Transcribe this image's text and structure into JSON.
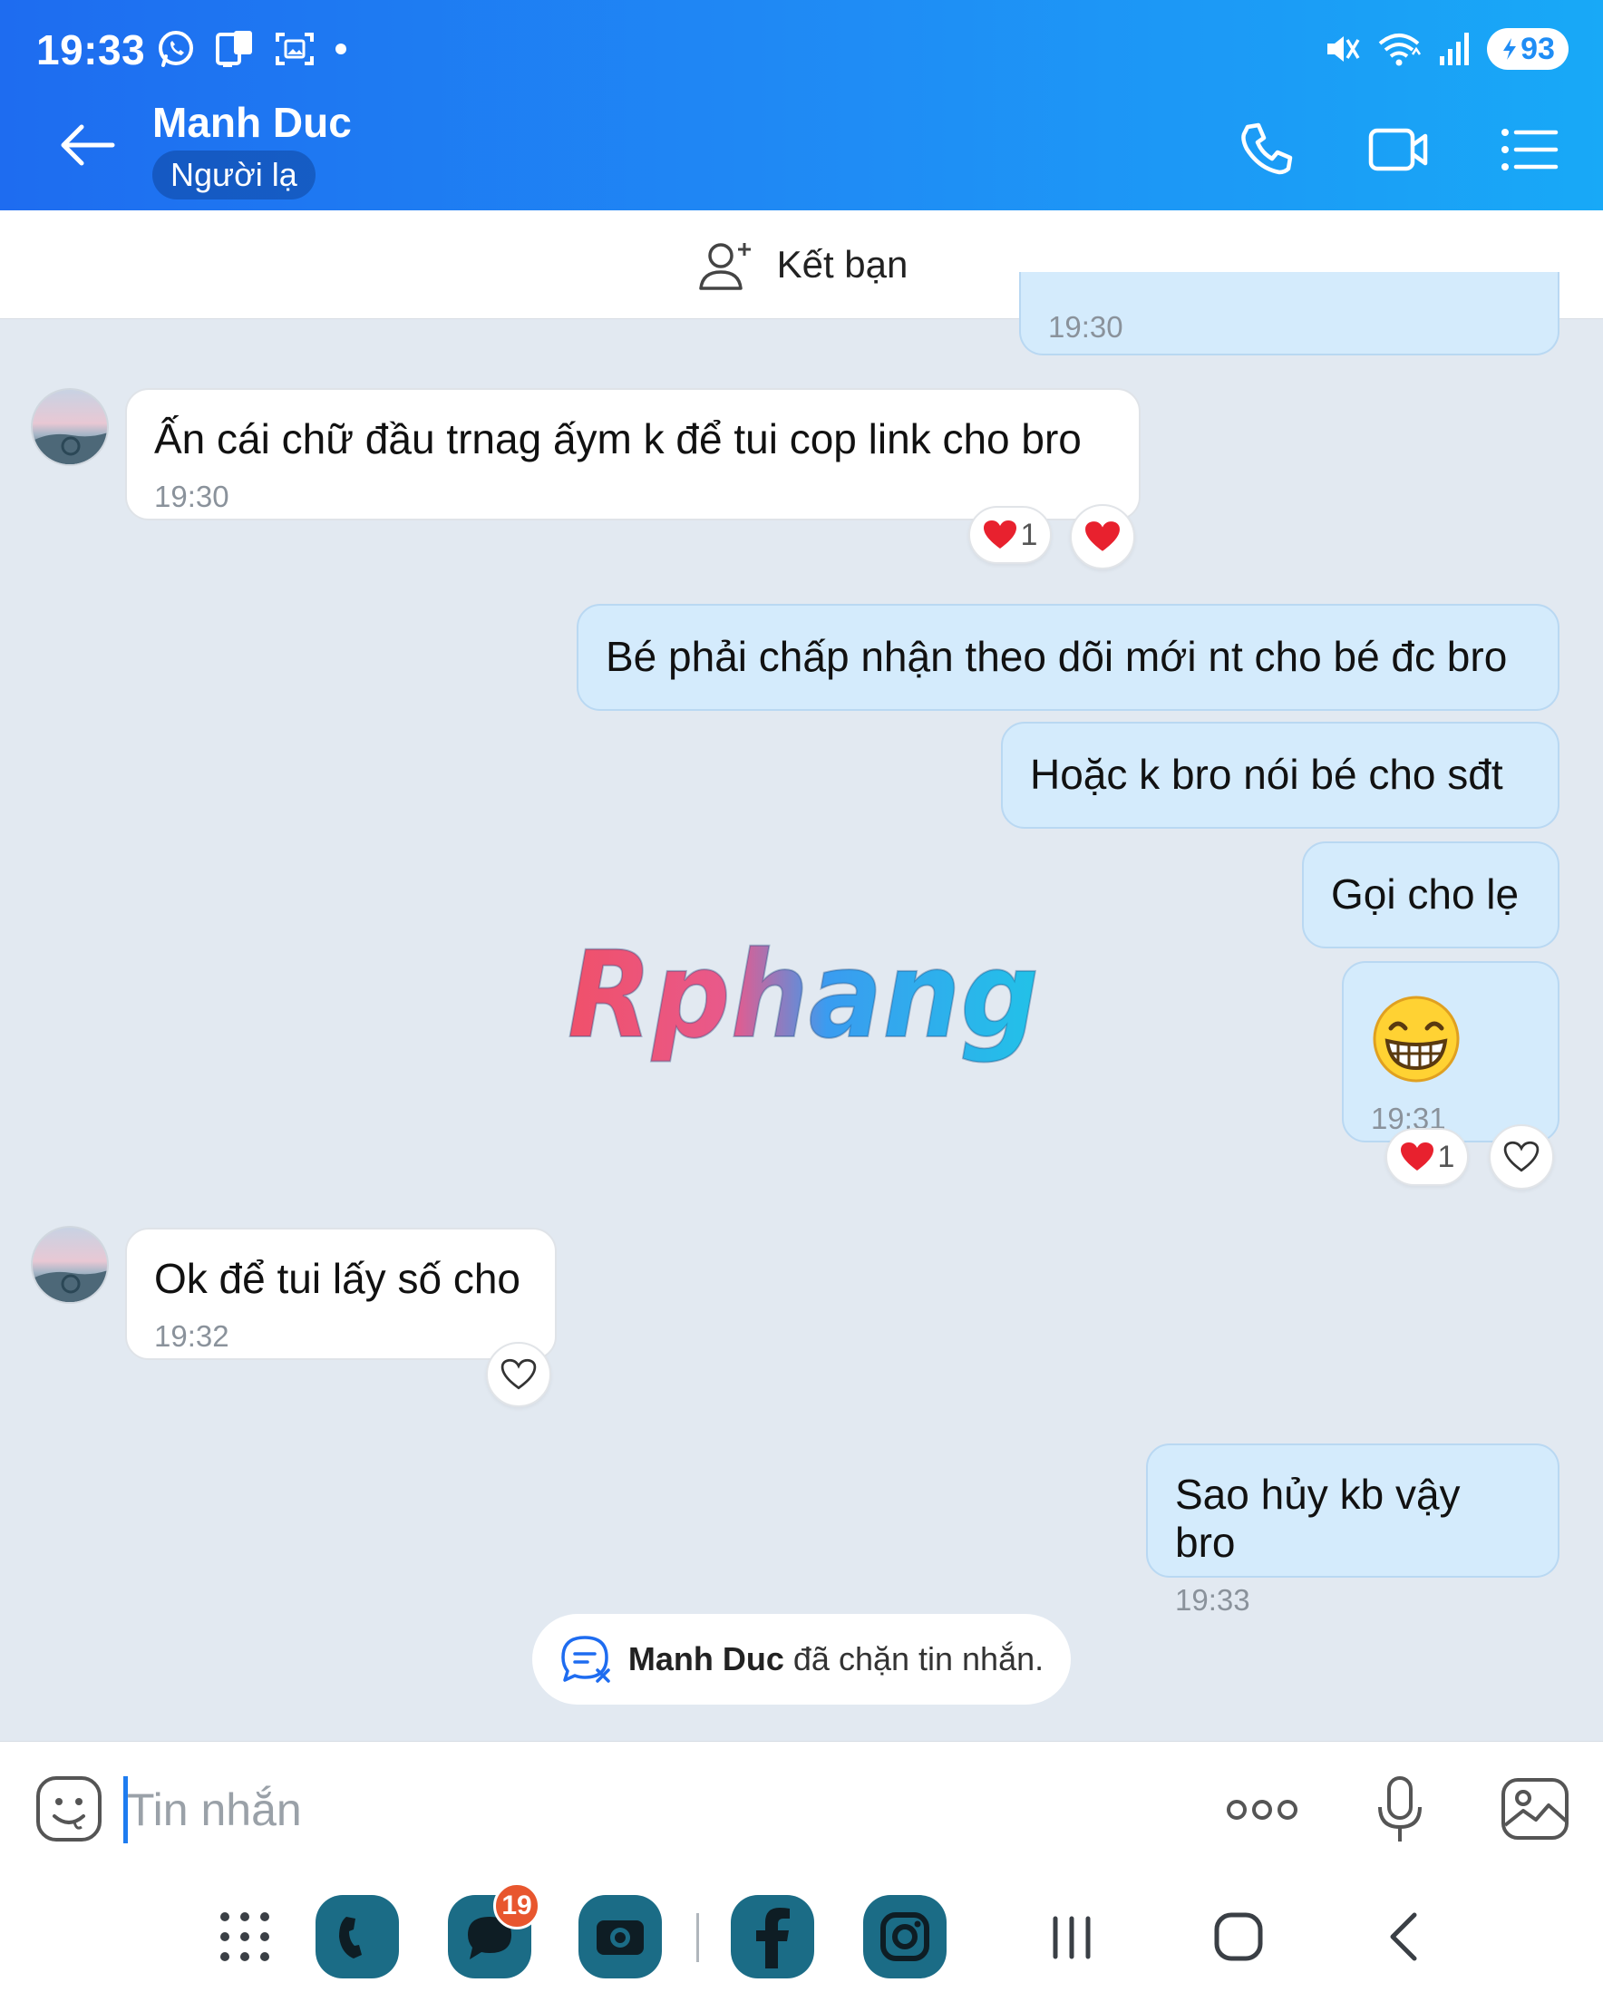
{
  "status_bar": {
    "time": "19:33",
    "battery": "93",
    "icons_left": [
      "whatsapp-icon",
      "phone-clone-icon",
      "screenshot-icon",
      "dot-icon"
    ],
    "icons_right": [
      "mute-icon",
      "wifi-icon",
      "signal-icon",
      "battery-icon"
    ]
  },
  "header": {
    "contact_name": "Manh Duc",
    "contact_status": "Người lạ",
    "actions": [
      "phone-icon",
      "video-icon",
      "list-menu-icon"
    ]
  },
  "friend_bar": {
    "label": "Kết bạn"
  },
  "messages": [
    {
      "direction": "out",
      "text": "",
      "time": "19:30",
      "partial": true
    },
    {
      "direction": "in",
      "text": "Ấn cái chữ đầu trnag ấym k để tui cop link cho bro",
      "time": "19:30",
      "reaction_count": "1"
    },
    {
      "direction": "out",
      "text": "Bé phải chấp nhận theo dõi mới nt cho bé đc bro"
    },
    {
      "direction": "out",
      "text": "Hoặc k bro nói bé cho sđt"
    },
    {
      "direction": "out",
      "text": "Gọi cho lẹ"
    },
    {
      "direction": "out",
      "text": "",
      "sticker": "grin-emoji",
      "time": "19:31",
      "reaction_count": "1"
    },
    {
      "direction": "in",
      "text": "Ok để tui lấy số cho",
      "time": "19:32"
    },
    {
      "direction": "out",
      "text": "Sao hủy kb vậy bro",
      "time": "19:33"
    }
  ],
  "watermark": {
    "text": "Rphang"
  },
  "system_note": {
    "name": "Manh Duc",
    "text": " đã chặn tin nhắn."
  },
  "composer": {
    "placeholder": "Tin nhắn",
    "value": ""
  },
  "nav_bar": {
    "apps": [
      "apps-grid-icon",
      "phone-app-icon",
      "messages-app-icon",
      "camera-app-icon",
      "facebook-app-icon",
      "instagram-app-icon"
    ],
    "messages_badge": "19",
    "buttons": [
      "recents-button",
      "home-button",
      "back-button"
    ]
  },
  "colors": {
    "header_start": "#1e6cf0",
    "header_end": "#18a9f7",
    "out_bubble": "#d4ebfc",
    "in_bubble": "#ffffff",
    "chat_bg": "#e2e9f1",
    "heart": "#e8212e"
  }
}
